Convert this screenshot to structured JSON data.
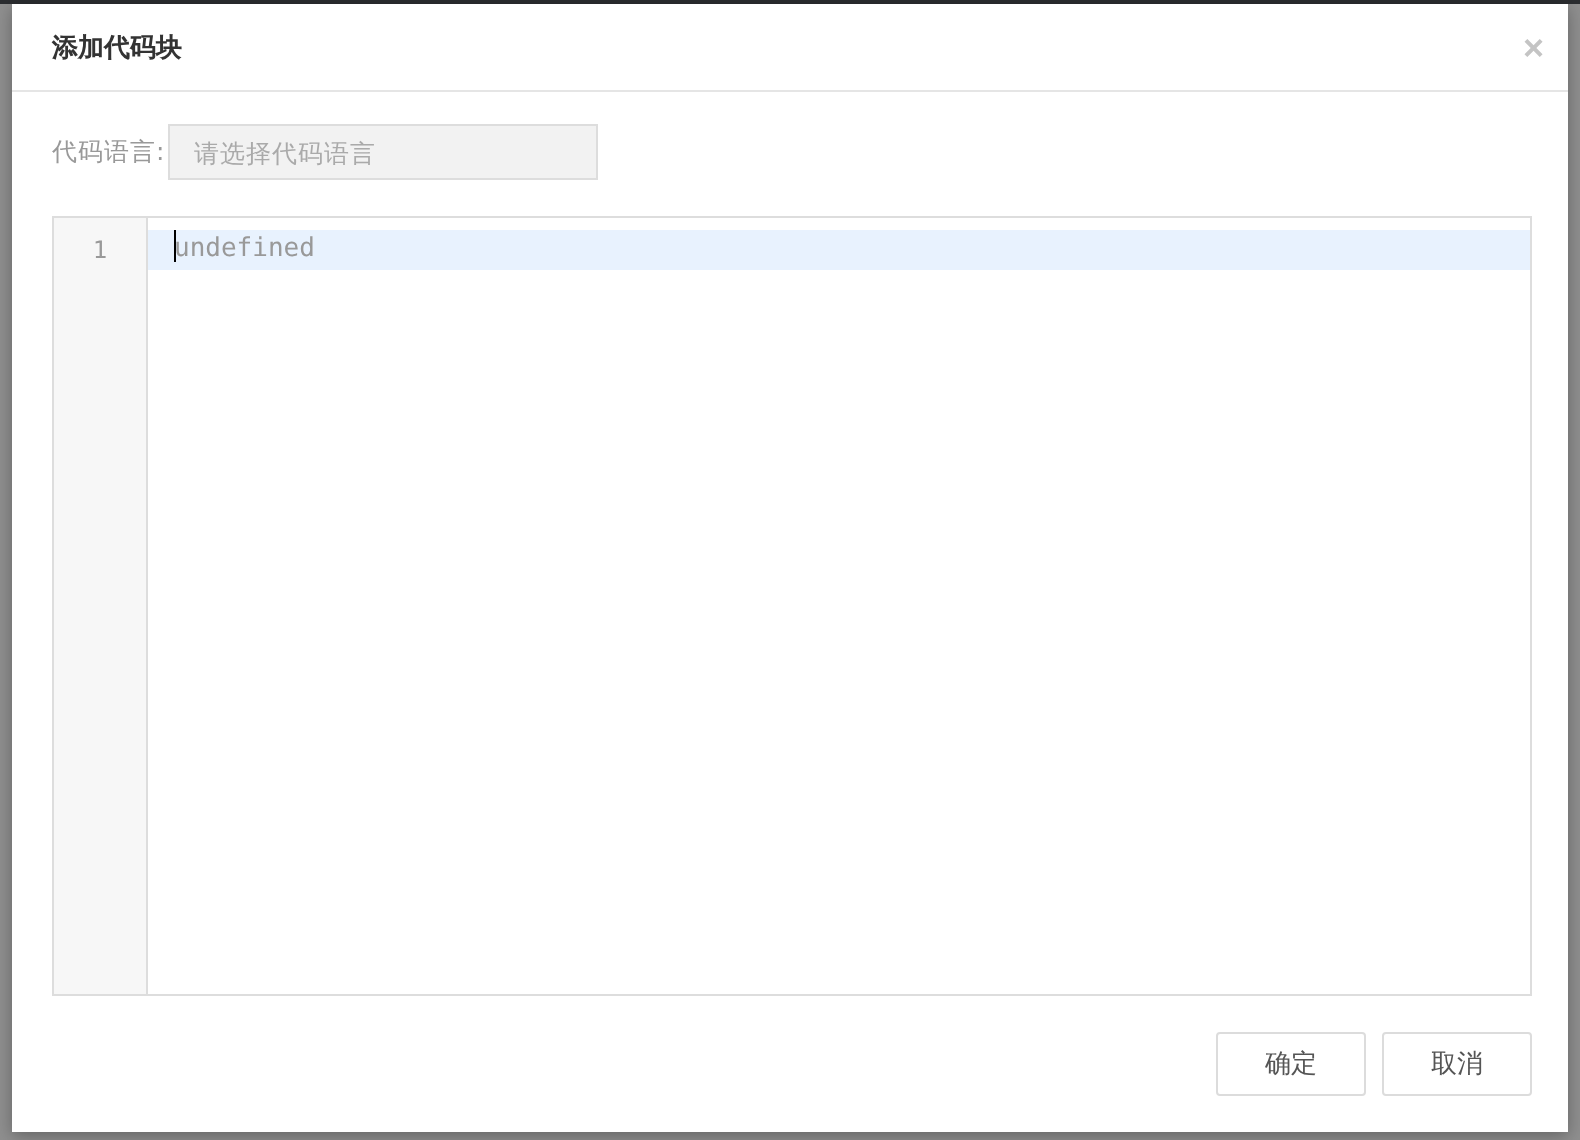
{
  "dialog": {
    "title": "添加代码块",
    "close": "×",
    "language": {
      "label": "代码语言:",
      "placeholder": "请选择代码语言"
    },
    "editor": {
      "lines": [
        {
          "number": "1",
          "text": "undefined",
          "active": true
        }
      ]
    },
    "buttons": [
      "确定",
      "取消"
    ]
  }
}
